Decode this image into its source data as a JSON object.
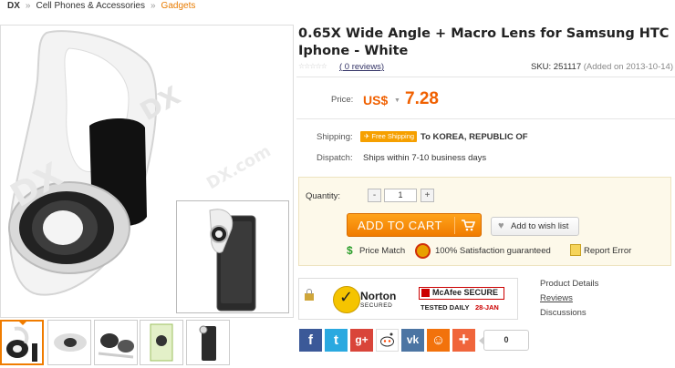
{
  "breadcrumb": {
    "home": "DX",
    "sep": "»",
    "level1": "Cell Phones & Accessories",
    "level2": "Gadgets"
  },
  "product": {
    "title": "0.65X Wide Angle + Macro Lens for Samsung HTC Iphone - White",
    "reviews_label": "( 0 reviews)",
    "sku_text": "SKU: 251117",
    "added_text": "(Added on 2013-10-14)",
    "price_label": "Price:",
    "currency": "US$",
    "price": "7.28",
    "shipping_label": "Shipping:",
    "free_shipping_badge": "Free Shipping",
    "shipping_dest": "To KOREA, REPUBLIC OF",
    "dispatch_label": "Dispatch:",
    "dispatch_value": "Ships within 7-10 business days"
  },
  "buy": {
    "quantity_label": "Quantity:",
    "minus": "-",
    "plus": "+",
    "quantity_value": "1",
    "add_to_cart": "ADD TO CART",
    "wishlist": "Add to wish list",
    "price_match": "Price Match",
    "satisfaction": "100% Satisfaction guaranteed",
    "report_error": "Report Error"
  },
  "security": {
    "norton_name": "Norton",
    "norton_sub": "SECURED",
    "mcafee_name": "McAfee SECURE",
    "mcafee_daily": "TESTED DAILY",
    "mcafee_date": "28-JAN"
  },
  "side_links": [
    "Product Details",
    "Reviews",
    "Discussions"
  ],
  "social": {
    "icons": [
      "facebook-icon",
      "twitter-icon",
      "google-plus-icon",
      "reddit-icon",
      "vk-icon",
      "odnoklassniki-icon",
      "share-plus-icon"
    ],
    "count": "0"
  },
  "colors": {
    "accent": "#f07c00",
    "price": "#f06000",
    "buybox_bg": "#fdf9ea"
  }
}
